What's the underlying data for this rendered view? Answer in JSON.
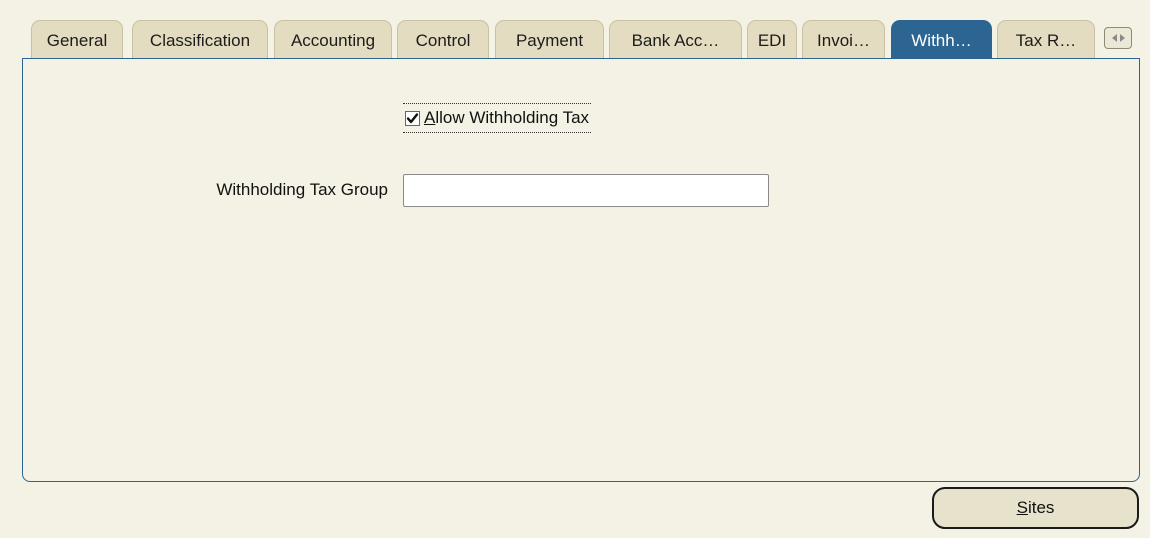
{
  "tabs": [
    {
      "label": "General",
      "active": false
    },
    {
      "label": "Classification",
      "active": false
    },
    {
      "label": "Accounting",
      "active": false
    },
    {
      "label": "Control",
      "active": false
    },
    {
      "label": "Payment",
      "active": false
    },
    {
      "label": "Bank Acc…",
      "active": false
    },
    {
      "label": "EDI",
      "active": false
    },
    {
      "label": "Invoi…",
      "active": false
    },
    {
      "label": "Withh…",
      "active": true
    },
    {
      "label": "Tax R…",
      "active": false
    }
  ],
  "withholding": {
    "allow_checkbox": {
      "mnemonic": "A",
      "label_rest": "llow Withholding Tax",
      "checked": true
    },
    "tax_group": {
      "label": "Withholding Tax Group",
      "value": ""
    }
  },
  "footer": {
    "sites_mnemonic": "S",
    "sites_rest": "ites"
  },
  "colors": {
    "background": "#f4f2e4",
    "tab_inactive": "#e3dcc0",
    "tab_active": "#2d6592",
    "panel_border": "#2d6592"
  },
  "icons": {
    "tab_scroll": "left-right-arrows-icon",
    "check": "checkmark-icon"
  }
}
